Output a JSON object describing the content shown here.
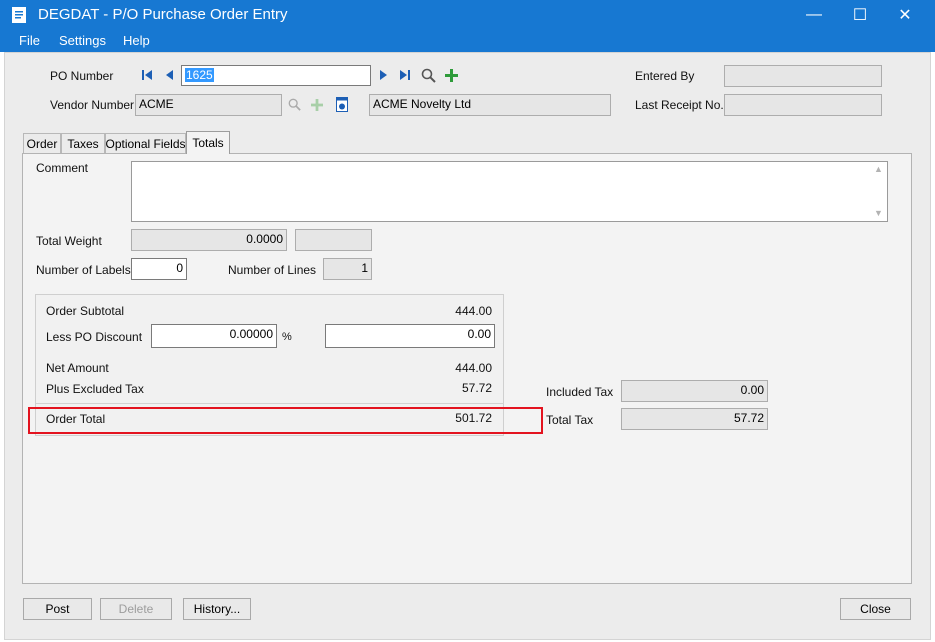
{
  "window": {
    "title": "DEGDAT - P/O Purchase Order Entry",
    "minimize_glyph": "—",
    "maximize_glyph": "☐",
    "close_glyph": "✕",
    "accent": "#1778d2"
  },
  "menu": {
    "file": "File",
    "settings": "Settings",
    "help": "Help"
  },
  "header": {
    "po_number_label": "PO Number",
    "po_number_value": "1625",
    "vendor_number_label": "Vendor Number",
    "vendor_number_value": "ACME",
    "vendor_name_value": "ACME Novelty Ltd",
    "entered_by_label": "Entered By",
    "entered_by_value": "",
    "last_receipt_label": "Last Receipt No.",
    "last_receipt_value": ""
  },
  "icons": {
    "first": "first-record-icon",
    "prev": "previous-record-icon",
    "next": "next-record-icon",
    "last": "last-record-icon",
    "finder": "search-icon",
    "new": "add-icon",
    "vendor_info": "vendor-info-icon"
  },
  "tabs": [
    {
      "label": "Order",
      "active": false
    },
    {
      "label": "Taxes",
      "active": false
    },
    {
      "label": "Optional Fields",
      "active": false
    },
    {
      "label": "Totals",
      "active": true
    }
  ],
  "totals": {
    "comment_label": "Comment",
    "comment_value": "",
    "total_weight_label": "Total Weight",
    "total_weight_value": "0.0000",
    "total_weight_unit": "",
    "number_of_labels_label": "Number of Labels",
    "number_of_labels_value": "0",
    "number_of_lines_label": "Number of Lines",
    "number_of_lines_value": "1",
    "order_subtotal_label": "Order Subtotal",
    "order_subtotal_value": "444.00",
    "less_po_discount_label": "Less PO Discount",
    "discount_percent_value": "0.00000",
    "percent_symbol": "%",
    "discount_amount_value": "0.00",
    "net_amount_label": "Net Amount",
    "net_amount_value": "444.00",
    "plus_excluded_tax_label": "Plus Excluded Tax",
    "plus_excluded_tax_value": "57.72",
    "order_total_label": "Order Total",
    "order_total_value": "501.72",
    "included_tax_label": "Included Tax",
    "included_tax_value": "0.00",
    "total_tax_label": "Total Tax",
    "total_tax_value": "57.72",
    "highlight_color": "#e3131f"
  },
  "buttons": {
    "post": "Post",
    "delete": "Delete",
    "history": "History...",
    "close": "Close"
  }
}
